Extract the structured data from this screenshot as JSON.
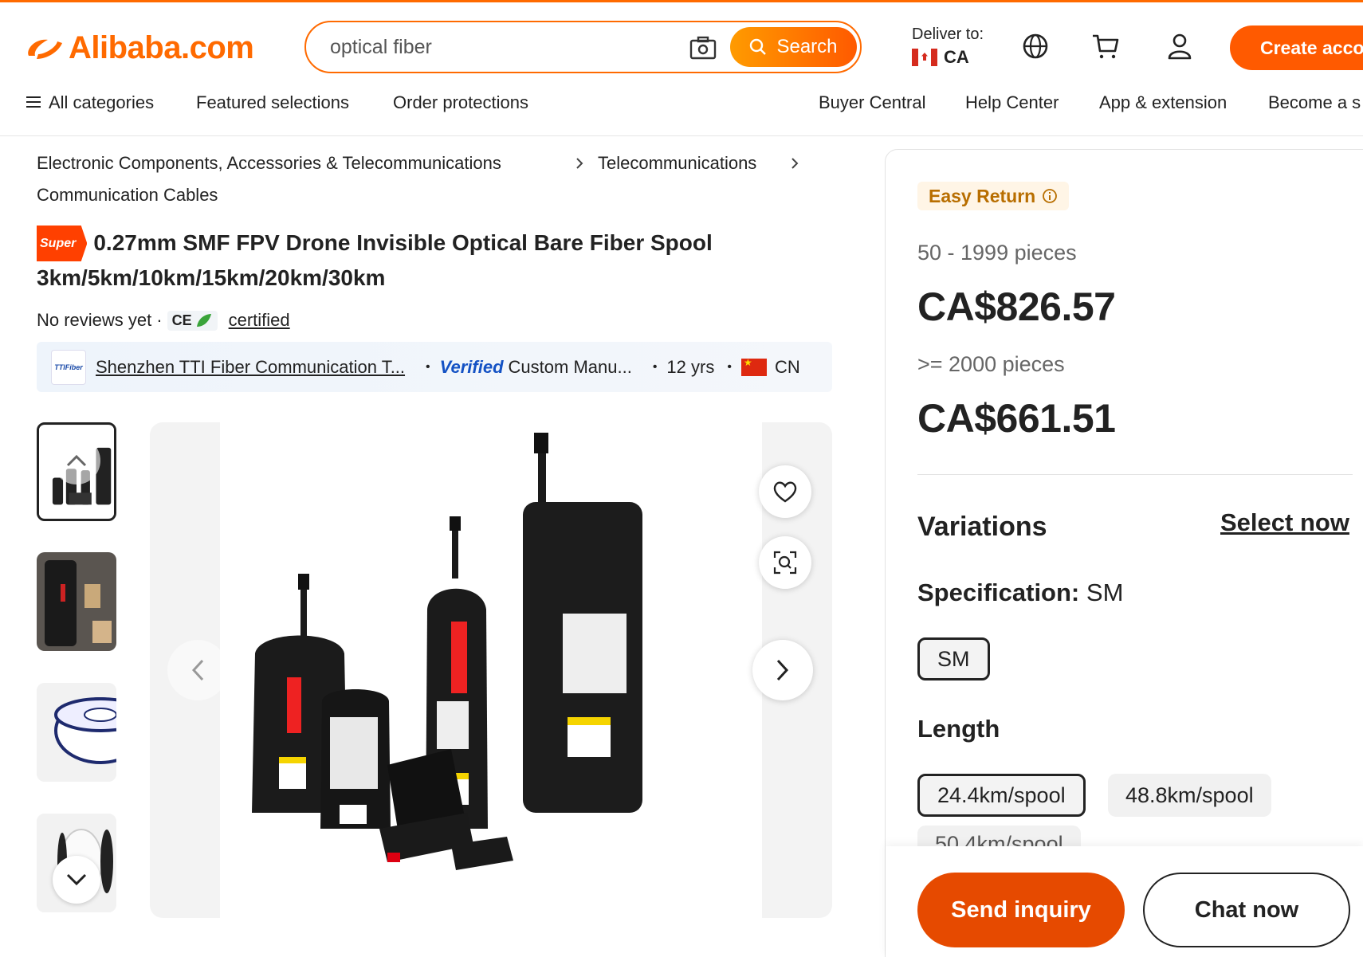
{
  "header": {
    "logo_text": "Alibaba.com",
    "search": {
      "value": "optical fiber",
      "button_label": "Search"
    },
    "deliver": {
      "label": "Deliver to:",
      "country_code": "CA"
    },
    "icons": [
      "globe-icon",
      "cart-icon",
      "user-icon"
    ],
    "create_account_label": "Create acco"
  },
  "nav": {
    "left": [
      "All categories",
      "Featured selections",
      "Order protections"
    ],
    "right": [
      "Buyer Central",
      "Help Center",
      "App & extension",
      "Become a s"
    ]
  },
  "breadcrumb": [
    "Electronic Components, Accessories & Telecommunications",
    "Telecommunications",
    "Communication Cables"
  ],
  "product": {
    "badge": "Super",
    "title_line1": "0.27mm SMF FPV Drone Invisible Optical Bare Fiber Spool",
    "title_line2": "3km/5km/10km/15km/20km/30km",
    "reviews": "No reviews yet",
    "ce_mark": "CE",
    "certified": "certified"
  },
  "supplier": {
    "logo_text": "TTIFiber",
    "name": "Shenzhen TTI Fiber Communication T...",
    "verified": "Verified",
    "type": "Custom Manu...",
    "years": "12 yrs",
    "country": "CN"
  },
  "pricing": {
    "easy_return": "Easy Return",
    "tiers": [
      {
        "qty": "50 - 1999 pieces",
        "price": "CA$826.57"
      },
      {
        "qty": ">= 2000 pieces",
        "price": "CA$661.51"
      }
    ]
  },
  "variations": {
    "title": "Variations",
    "select_now": "Select now",
    "spec_label": "Specification:",
    "spec_value": "SM",
    "spec_options": [
      "SM"
    ],
    "length_label": "Length",
    "length_options": [
      "24.4km/spool",
      "48.8km/spool",
      "50.4km/spool"
    ]
  },
  "actions": {
    "send_inquiry": "Send inquiry",
    "chat_now": "Chat now"
  },
  "colors": {
    "brand": "#ff6a00",
    "send": "#e64a00",
    "verified": "#1452c4"
  }
}
